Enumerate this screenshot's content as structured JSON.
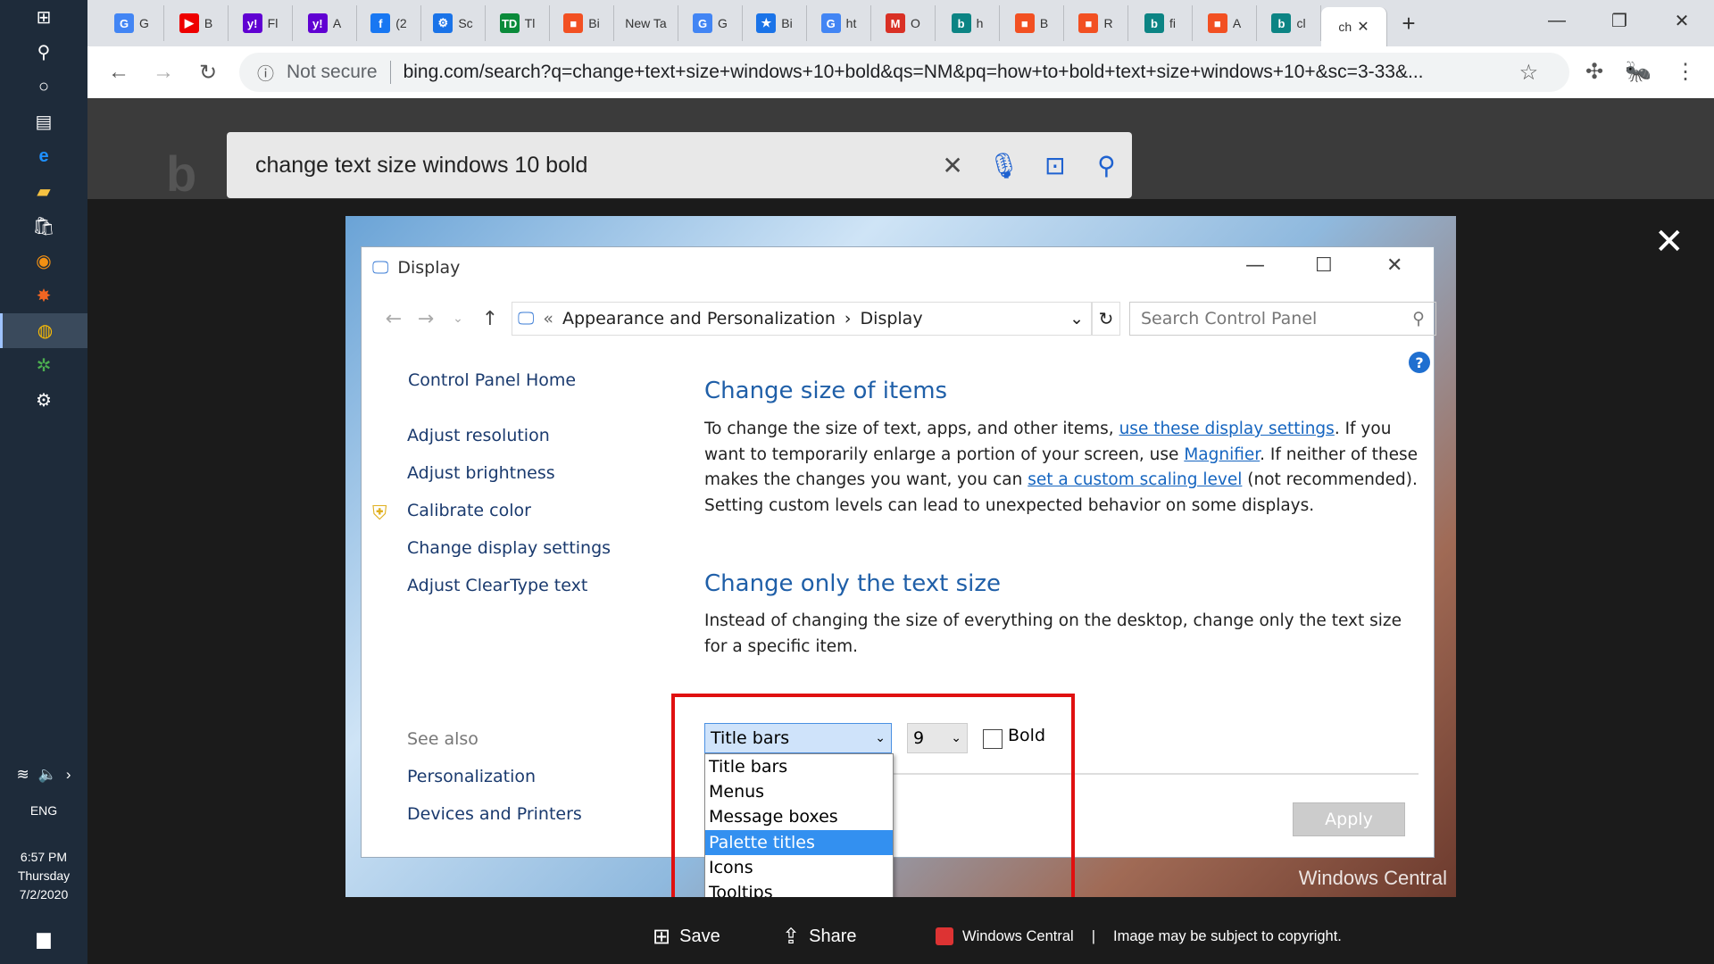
{
  "taskbar": {
    "icons": [
      "windows-start-icon",
      "search-icon",
      "cortana-icon",
      "task-view-icon",
      "edge-icon",
      "file-explorer-icon",
      "store-icon",
      "firefox-icon",
      "avast-icon",
      "chrome-icon",
      "green-app-icon",
      "settings-icon"
    ],
    "tray_lang": "ENG",
    "time": "6:57 PM",
    "day": "Thursday",
    "date": "7/2/2020"
  },
  "chrome": {
    "tabs": [
      {
        "label": "G",
        "fav": "G",
        "color": "#4285f4"
      },
      {
        "label": "B",
        "fav": "▶",
        "color": "#e00"
      },
      {
        "label": "Fl",
        "fav": "y!",
        "color": "#6001d2"
      },
      {
        "label": "A",
        "fav": "y!",
        "color": "#6001d2"
      },
      {
        "label": "(2",
        "fav": "f",
        "color": "#1877f2"
      },
      {
        "label": "Sc",
        "fav": "⚙",
        "color": "#1a73e8"
      },
      {
        "label": "Tl",
        "fav": "TD",
        "color": "#0a8a3a"
      },
      {
        "label": "Bi",
        "fav": "■",
        "color": "#f25022"
      },
      {
        "label": "New Ta",
        "fav": "",
        "color": "#fff"
      },
      {
        "label": "G",
        "fav": "G",
        "color": "#4285f4"
      },
      {
        "label": "Bi",
        "fav": "★",
        "color": "#1a73e8"
      },
      {
        "label": "ht",
        "fav": "G",
        "color": "#4285f4"
      },
      {
        "label": "O",
        "fav": "M",
        "color": "#d93025"
      },
      {
        "label": "h",
        "fav": "b",
        "color": "#0c8484"
      },
      {
        "label": "B",
        "fav": "■",
        "color": "#f25022"
      },
      {
        "label": "R",
        "fav": "■",
        "color": "#f25022"
      },
      {
        "label": "fi",
        "fav": "b",
        "color": "#0c8484"
      },
      {
        "label": "A",
        "fav": "■",
        "color": "#f25022"
      },
      {
        "label": "cl",
        "fav": "b",
        "color": "#0c8484"
      }
    ],
    "active_tab_label": "ch",
    "security": "Not secure",
    "url": "bing.com/search?q=change+text+size+windows+10+bold&qs=NM&pq=how+to+bold+text+size+windows+10+&sc=3-33&..."
  },
  "bing": {
    "query": "change text size windows 10 bold"
  },
  "control_panel": {
    "title": "Display",
    "breadcrumb_root": "Appearance and Personalization",
    "breadcrumb_leaf": "Display",
    "search_placeholder": "Search Control Panel",
    "left_links": [
      "Control Panel Home",
      "Adjust resolution",
      "Adjust brightness",
      "Calibrate color",
      "Change display settings",
      "Adjust ClearType text"
    ],
    "see_also_label": "See also",
    "see_also_links": [
      "Personalization",
      "Devices and Printers"
    ],
    "heading1": "Change size of items",
    "para1_a": "To change the size of text, apps, and other items, ",
    "para1_link1": "use these display settings",
    "para1_b": ".  If you want to temporarily enlarge a portion of your screen, use ",
    "para1_link2": "Magnifier",
    "para1_c": ".  If neither of these makes the changes you want, you can ",
    "para1_link3": "set a custom scaling level",
    "para1_d": " (not recommended).  Setting custom levels can lead to unexpected behavior on some displays.",
    "heading2": "Change only the text size",
    "para2": "Instead of changing the size of everything on the desktop, change only the text size for a specific item.",
    "item_selected": "Title bars",
    "size_selected": "9",
    "bold_label": "Bold",
    "dropdown_items": [
      "Title bars",
      "Menus",
      "Message boxes",
      "Palette titles",
      "Icons",
      "Tooltips"
    ],
    "dropdown_highlight": 3,
    "apply_label": "Apply"
  },
  "image_credit": "Windows Central",
  "bottom": {
    "save": "Save",
    "share": "Share",
    "source": "Windows Central",
    "sep": "|",
    "copyright": "Image may be subject to copyright."
  }
}
